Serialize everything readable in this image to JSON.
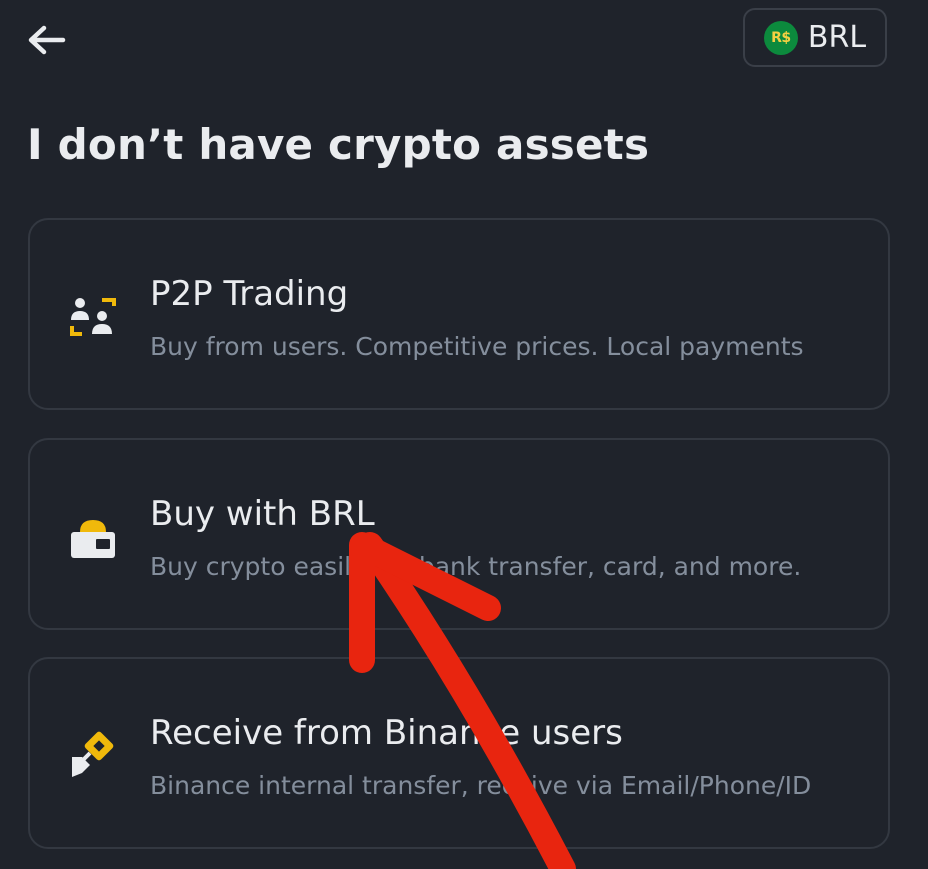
{
  "header": {
    "back_icon": "arrow-left-icon",
    "currency": {
      "badge": "R$",
      "code": "BRL",
      "badge_color": "#0c8a3d"
    }
  },
  "title": "I don’t have crypto assets",
  "options": [
    {
      "icon": "p2p-users-icon",
      "title": "P2P Trading",
      "description": "Buy from users. Competitive prices. Local payments"
    },
    {
      "icon": "wallet-card-icon",
      "title": "Buy with BRL",
      "description": "Buy crypto easily via bank transfer, card, and more."
    },
    {
      "icon": "receive-transfer-icon",
      "title": "Receive from Binance users",
      "description": "Binance internal transfer, receive via Email/Phone/ID"
    }
  ],
  "colors": {
    "background": "#1f232b",
    "card_border": "#333841",
    "text_primary": "#eaecef",
    "text_secondary": "#848e9c",
    "accent": "#f0b90b",
    "annotation": "#e8250f"
  }
}
